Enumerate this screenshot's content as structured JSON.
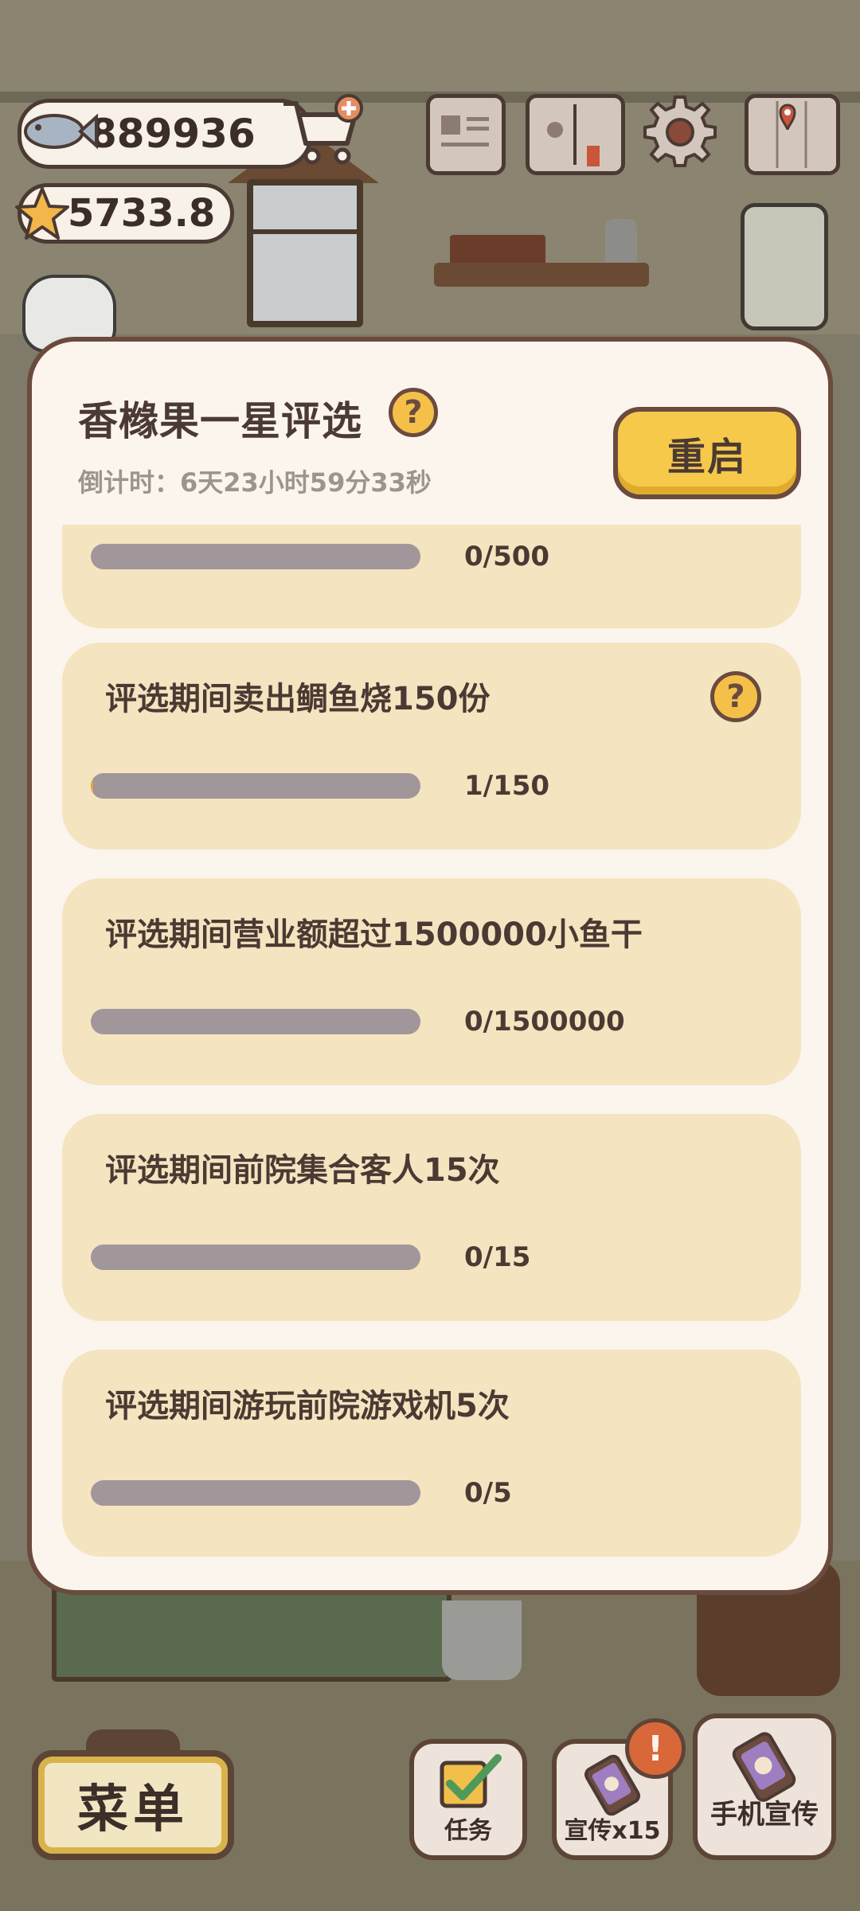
{
  "hud": {
    "coins": "889936",
    "stars": "5733.8"
  },
  "modal": {
    "title": "香橼果一星评选",
    "help_glyph": "?",
    "countdown": "倒计时：6天23小时59分33秒",
    "restart_label": "重启",
    "tasks": [
      {
        "text": "",
        "progress_text": "0/500",
        "progress": 0
      },
      {
        "text": "评选期间卖出鲷鱼烧150份",
        "progress_text": "1/150",
        "progress": 0.0067
      },
      {
        "text": "评选期间营业额超过1500000小鱼干",
        "progress_text": "0/1500000",
        "progress": 0
      },
      {
        "text": "评选期间前院集合客人15次",
        "progress_text": "0/15",
        "progress": 0
      },
      {
        "text": "评选期间游玩前院游戏机5次",
        "progress_text": "0/5",
        "progress": 0
      }
    ]
  },
  "bottom_bar": {
    "menu_label": "菜单",
    "task_label": "任务",
    "promo_label": "宣传x15",
    "phone_label": "手机宣传",
    "alert_glyph": "!"
  },
  "colors": {
    "panel": "#fcf5ee",
    "card": "#f4e4c0",
    "track": "#a1969a",
    "accent": "#f7c94a",
    "text": "#4b3a33"
  },
  "icons": [
    "fish-icon",
    "star-icon",
    "cart-icon",
    "newspaper-icon",
    "book-icon",
    "gear-icon",
    "map-icon",
    "checkbox-icon",
    "phone-icon"
  ]
}
